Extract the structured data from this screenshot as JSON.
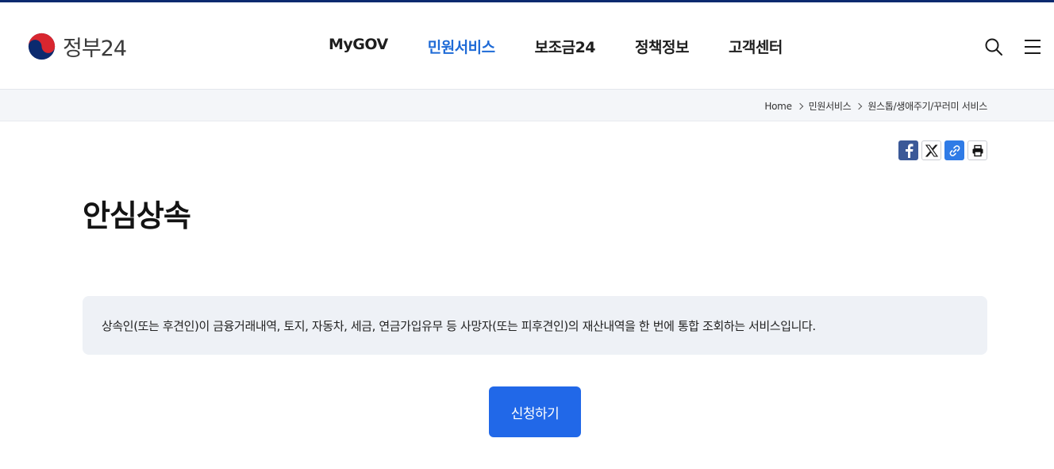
{
  "brand": {
    "logo_text": "정부24"
  },
  "nav": {
    "items": [
      {
        "label": "MyGOV"
      },
      {
        "label": "민원서비스"
      },
      {
        "label": "보조금24"
      },
      {
        "label": "정책정보"
      },
      {
        "label": "고객센터"
      }
    ],
    "active_index": 1
  },
  "icons": {
    "search": "search-icon",
    "menu": "hamburger-menu-icon"
  },
  "breadcrumb": {
    "items": [
      "Home",
      "민원서비스",
      "원스톱/생애주기/꾸러미 서비스"
    ]
  },
  "share": {
    "facebook": "facebook-icon",
    "x": "x-icon",
    "link": "link-icon",
    "print": "print-icon"
  },
  "page": {
    "title": "안심상속",
    "description": "상속인(또는 후견인)이 금융거래내역, 토지, 자동차, 세금, 연금가입유무 등 사망자(또는 피후견인)의 재산내역을 한 번에 통합 조회하는 서비스입니다.",
    "apply_label": "신청하기"
  },
  "colors": {
    "accent": "#1e6ad6",
    "button": "#2168e8",
    "top_bar": "#0b2a6f",
    "desc_bg": "#eef1f6"
  }
}
